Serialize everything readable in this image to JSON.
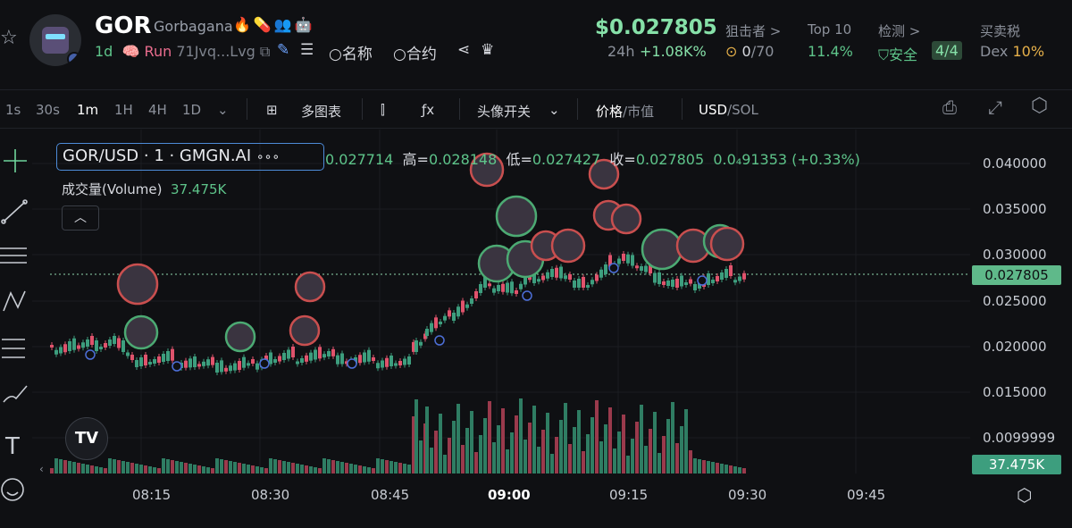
{
  "token": {
    "symbol": "GOR",
    "name": "Gorbagana",
    "age": "1d",
    "status": "Run",
    "address": "71Jvq...Lvg"
  },
  "header_tools": {
    "name_label": "名称",
    "contract_label": "合约"
  },
  "price": {
    "value": "$0.027805",
    "change_label": "24h",
    "change": "+1.08K%"
  },
  "stats": {
    "snipers_label": "狙击者 >",
    "snipers_value": "0",
    "snipers_total": "/70",
    "top10_label": "Top 10",
    "top10_value": "11.4%",
    "check_label": "检测 >",
    "check_value": "安全",
    "check_badge": "4/4",
    "tax_label": "买卖税",
    "tax_platform": "Dex",
    "tax_value": "10%"
  },
  "timeframes": [
    "1s",
    "30s",
    "1m",
    "1H",
    "4H",
    "1D"
  ],
  "active_timeframe": "1m",
  "toolbar": {
    "multi_chart": "多图表",
    "avatar_toggle": "头像开关",
    "price_label": "价格",
    "mcap_label": "/市值",
    "usd_label": "USD",
    "sol_label": "/SOL"
  },
  "chart_header": {
    "pair": "GOR/USD · 1 · GMGN.AI",
    "more": "∘∘∘",
    "open": "0.027714",
    "high_label": "高=",
    "high": "0.028148",
    "low_label": "低=",
    "low": "0.027427",
    "close_label": "收=",
    "close": "0.027805",
    "change": "0.0₄91353 (+0.33%)",
    "volume_label": "成交量(Volume)",
    "volume_value": "37.475K"
  },
  "chart_data": {
    "type": "candlestick",
    "y_ticks": [
      "0.040000",
      "0.035000",
      "0.030000",
      "0.025000",
      "0.020000",
      "0.015000",
      "0.0099999"
    ],
    "ylim": [
      0.008,
      0.042
    ],
    "x_ticks": [
      "08:15",
      "08:30",
      "08:45",
      "09:00",
      "09:15",
      "09:30",
      "09:45"
    ],
    "last_price_label": "0.027805",
    "last_volume_label": "37.475K",
    "colors": {
      "up": "#3d9e7e",
      "down": "#e0536c",
      "up_vol": "#2f7d63",
      "down_vol": "#9a3a4c"
    }
  }
}
